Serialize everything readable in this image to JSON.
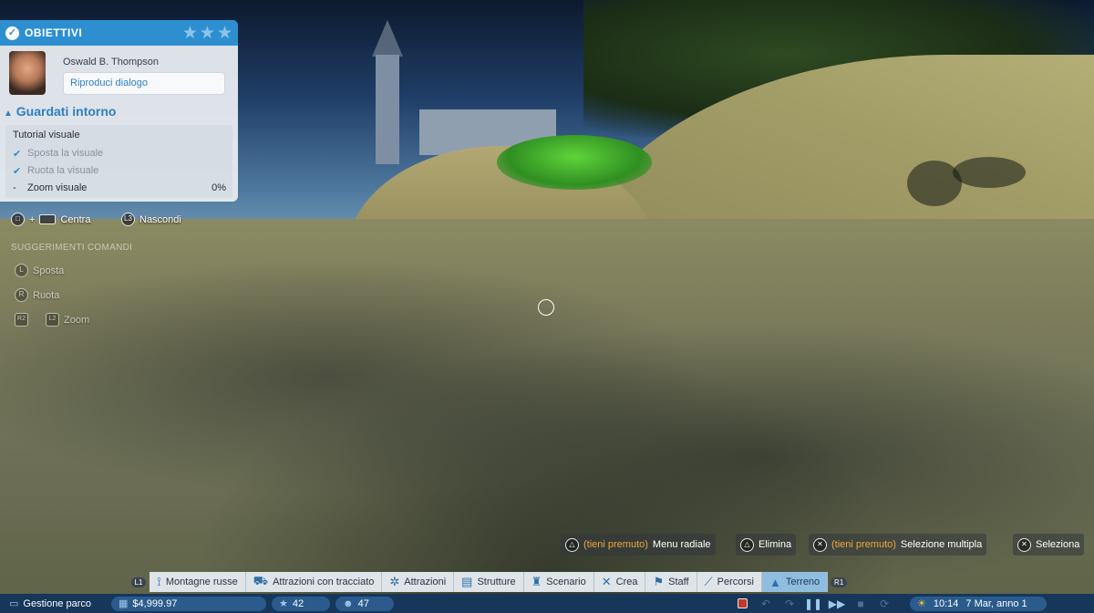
{
  "objectives": {
    "header": "OBIETTIVI",
    "advisor_name": "Oswald B. Thompson",
    "dialog_button": "Riproduci dialogo",
    "section_title": "Guardati intorno",
    "tutorial_title": "Tutorial visuale",
    "tasks": [
      {
        "label": "Sposta la visuale",
        "status": "done"
      },
      {
        "label": "Ruota la visuale",
        "status": "done"
      },
      {
        "label": "Zoom visuale",
        "status": "active",
        "progress": "0%"
      }
    ]
  },
  "camera_prompts": {
    "center": "Centra",
    "hide": "Nascondi",
    "shortcuts_title": "SUGGERIMENTI COMANDI",
    "move": "Sposta",
    "rotate": "Ruota",
    "zoom": "Zoom",
    "r2": "R2",
    "l2": "L2",
    "l": "L",
    "r": "R",
    "l3": "L3"
  },
  "actions": {
    "hold_label": "(tieni premuto)",
    "radial_menu": "Menu radiale",
    "delete": "Elimina",
    "multi_select": "Selezione multipla",
    "select": "Seleziona"
  },
  "tabs": {
    "left_trigger": "L1",
    "right_trigger": "R1",
    "items": [
      {
        "label": "Montagne russe",
        "icon": "rollercoaster-icon"
      },
      {
        "label": "Attrazioni con tracciato",
        "icon": "track-ride-icon"
      },
      {
        "label": "Attrazioni",
        "icon": "ride-icon"
      },
      {
        "label": "Strutture",
        "icon": "shop-icon"
      },
      {
        "label": "Scenario",
        "icon": "tower-icon"
      },
      {
        "label": "Crea",
        "icon": "tools-icon"
      },
      {
        "label": "Staff",
        "icon": "staff-icon"
      },
      {
        "label": "Percorsi",
        "icon": "path-icon"
      },
      {
        "label": "Terreno",
        "icon": "terrain-icon"
      }
    ],
    "active_index": 8
  },
  "status": {
    "park_management": "Gestione parco",
    "money": "$4,999.97",
    "rating": "42",
    "guests": "47",
    "time": "10:14",
    "date": "7 Mar, anno 1"
  },
  "colors": {
    "accent": "#2e8fd0",
    "status_bar": "#16375a",
    "hold_text": "#f0a83a"
  }
}
